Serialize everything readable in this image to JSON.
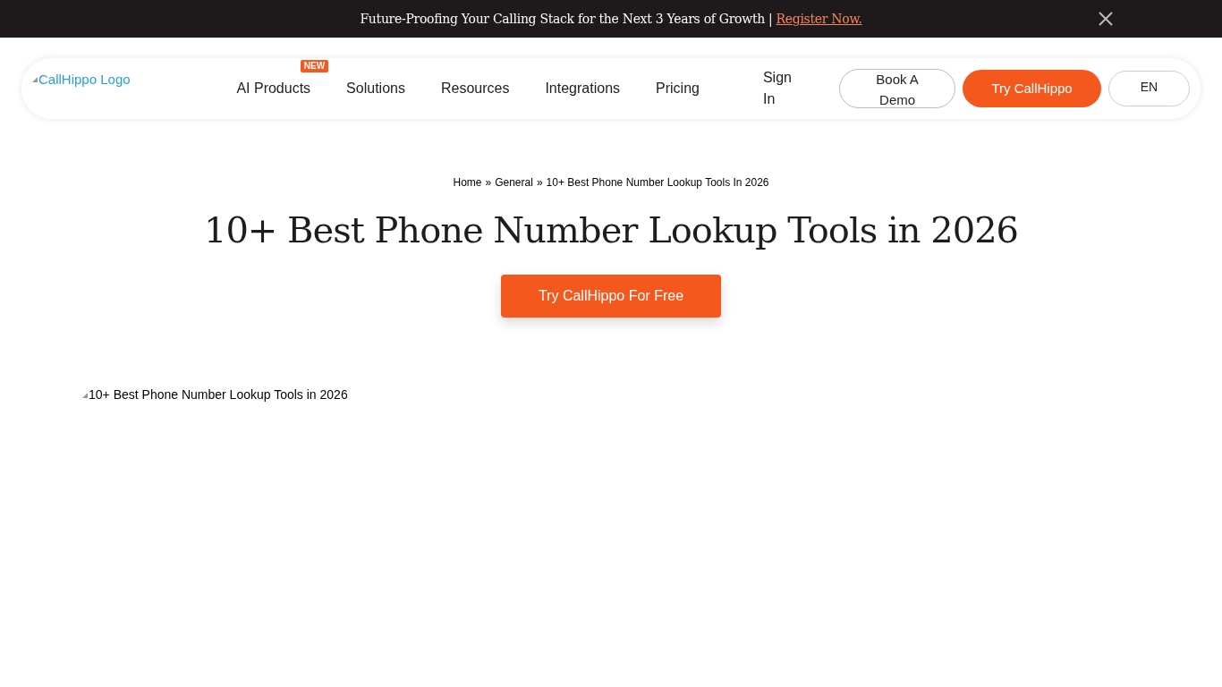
{
  "banner": {
    "text": "Future-Proofing Your Calling Stack for the Next 3 Years of Growth |",
    "link": "Register Now."
  },
  "nav": {
    "logo_alt": "CallHippo Logo",
    "items": [
      {
        "label": "AI Products",
        "badge": "NEW"
      },
      {
        "label": "Solutions"
      },
      {
        "label": "Resources"
      },
      {
        "label": "Integrations"
      },
      {
        "label": "Pricing"
      }
    ],
    "sign_in": "Sign In",
    "demo": "Book A Demo",
    "try": "Try CallHippo",
    "language": "EN"
  },
  "breadcrumb": [
    "Home",
    "General",
    "10+ Best Phone Number Lookup Tools In 2026"
  ],
  "breadcrumb_separator": "»",
  "title": "10+ Best Phone Number Lookup Tools in 2026",
  "cta": "Try CallHippo For Free",
  "hero_image_alt": "10+ Best Phone Number Lookup Tools in 2026"
}
